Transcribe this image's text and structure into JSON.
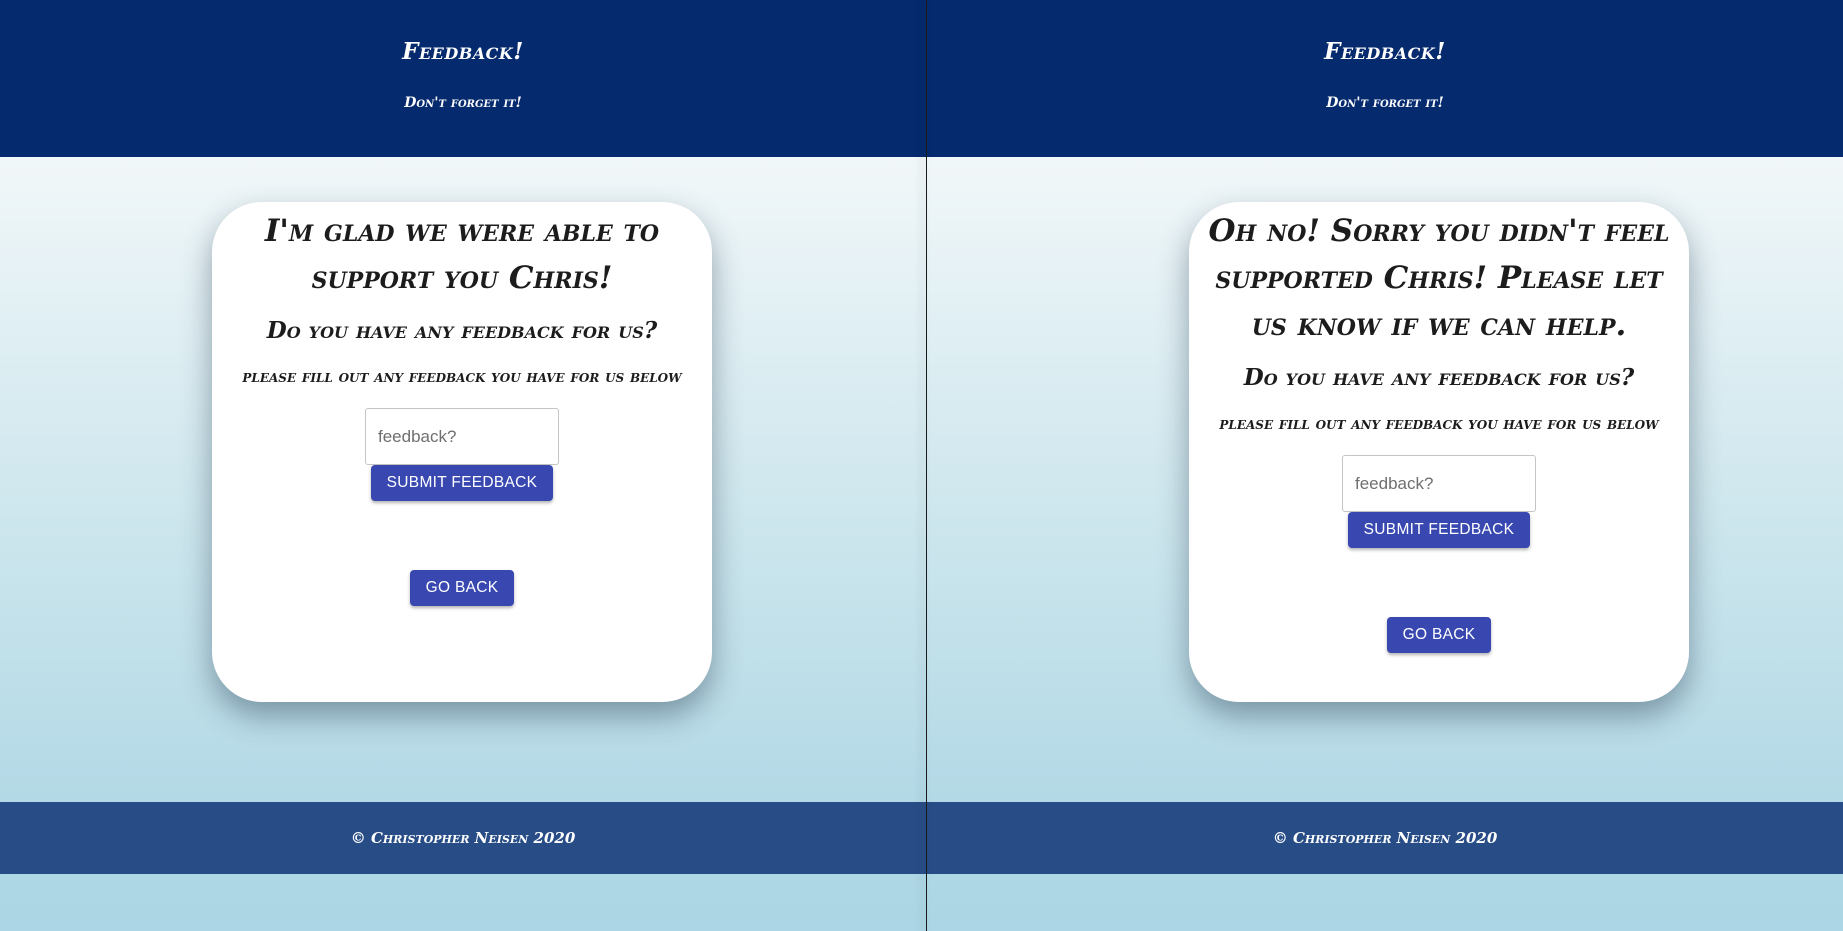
{
  "header": {
    "title": "Feedback!",
    "subtitle": "Don't forget it!"
  },
  "left_panel": {
    "heading": "I'm glad we were able to support you Chris!",
    "question": "Do you have any feedback for us?",
    "instructions": "please fill out any feedback you have for us below",
    "input_placeholder": "feedback?",
    "submit_label": "Submit Feedback",
    "back_label": "Go Back"
  },
  "right_panel": {
    "heading": "Oh no! Sorry you didn't feel supported Chris! Please let us know if we can help.",
    "question": "Do you have any feedback for us?",
    "instructions": "please fill out any feedback you have for us below",
    "input_placeholder": "feedback?",
    "submit_label": "Submit Feedback",
    "back_label": "Go Back"
  },
  "footer": {
    "copyright": "© Christopher Neisen 2020"
  },
  "colors": {
    "header_bg": "#052a6e",
    "footer_bg": "#284d86",
    "button_bg": "#3848b0",
    "card_bg": "#ffffff"
  }
}
